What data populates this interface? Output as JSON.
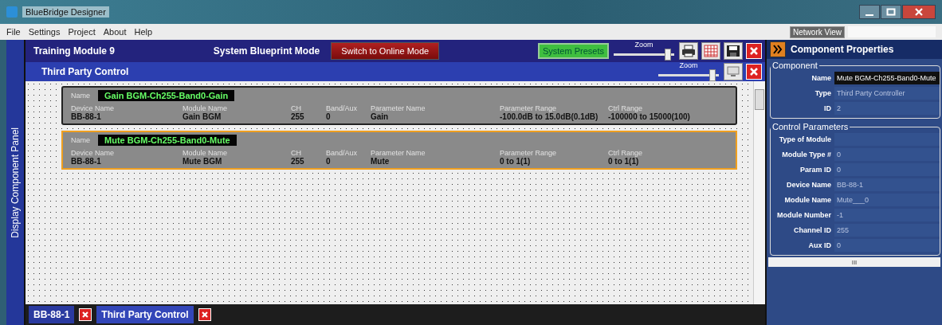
{
  "window": {
    "title": "BlueBridge Designer"
  },
  "menu": [
    "File",
    "Settings",
    "Project",
    "About",
    "Help"
  ],
  "network_view": "Network View",
  "side_tab": "Display Component Panel",
  "header": {
    "title": "Training Module 9",
    "mode": "System Blueprint Mode",
    "switch_button": "Switch to Online Mode",
    "presets_button": "System Presets",
    "zoom_label": "Zoom",
    "zoom": {
      "level": 0.95
    }
  },
  "subheader": {
    "title": "Third Party Control",
    "zoom_label": "Zoom",
    "zoom": {
      "level": 0.95
    }
  },
  "cards": [
    {
      "name_label": "Name",
      "name": "Gain BGM-Ch255-Band0-Gain",
      "selected": false,
      "fields": [
        {
          "label": "Device Name",
          "value": "BB-88-1"
        },
        {
          "label": "Module Name",
          "value": "Gain BGM"
        },
        {
          "label": "CH",
          "value": "255"
        },
        {
          "label": "Band/Aux",
          "value": "0"
        },
        {
          "label": "Parameter Name",
          "value": "Gain"
        },
        {
          "label": "Parameter Range",
          "value": "-100.0dB to 15.0dB(0.1dB)"
        },
        {
          "label": "Ctrl Range",
          "value": "-100000 to 15000(100)"
        }
      ]
    },
    {
      "name_label": "Name",
      "name": "Mute BGM-Ch255-Band0-Mute",
      "selected": true,
      "fields": [
        {
          "label": "Device Name",
          "value": "BB-88-1"
        },
        {
          "label": "Module Name",
          "value": "Mute BGM"
        },
        {
          "label": "CH",
          "value": "255"
        },
        {
          "label": "Band/Aux",
          "value": "0"
        },
        {
          "label": "Parameter Name",
          "value": "Mute"
        },
        {
          "label": "Parameter Range",
          "value": "0 to 1(1)"
        },
        {
          "label": "Ctrl Range",
          "value": "0 to 1(1)"
        }
      ]
    }
  ],
  "bottom_tabs": [
    {
      "label": "BB-88-1",
      "selected": false
    },
    {
      "label": "Third Party Control",
      "selected": true
    }
  ],
  "properties": {
    "title": "Component Properties",
    "groups": [
      {
        "title": "Component",
        "rows": [
          {
            "label": "Name",
            "value": "Mute BGM-Ch255-Band0-Mute",
            "highlight": true
          },
          {
            "label": "Type",
            "value": "Third Party Controller",
            "highlight": false
          },
          {
            "label": "ID",
            "value": "2",
            "highlight": false
          }
        ]
      },
      {
        "title": "Control Parameters",
        "rows": [
          {
            "label": "Type of Module",
            "value": "",
            "highlight": false
          },
          {
            "label": "Module Type #",
            "value": "0",
            "highlight": false
          },
          {
            "label": "Param ID",
            "value": "0",
            "highlight": false
          },
          {
            "label": "Device Name",
            "value": "BB-88-1",
            "highlight": false
          },
          {
            "label": "Module Name",
            "value": "Mute___0",
            "highlight": false
          },
          {
            "label": "Module Number",
            "value": "-1",
            "highlight": false
          },
          {
            "label": "Channel ID",
            "value": "255",
            "highlight": false
          },
          {
            "label": "Aux ID",
            "value": "0",
            "highlight": false
          }
        ]
      }
    ],
    "scroll_mark": "III"
  }
}
